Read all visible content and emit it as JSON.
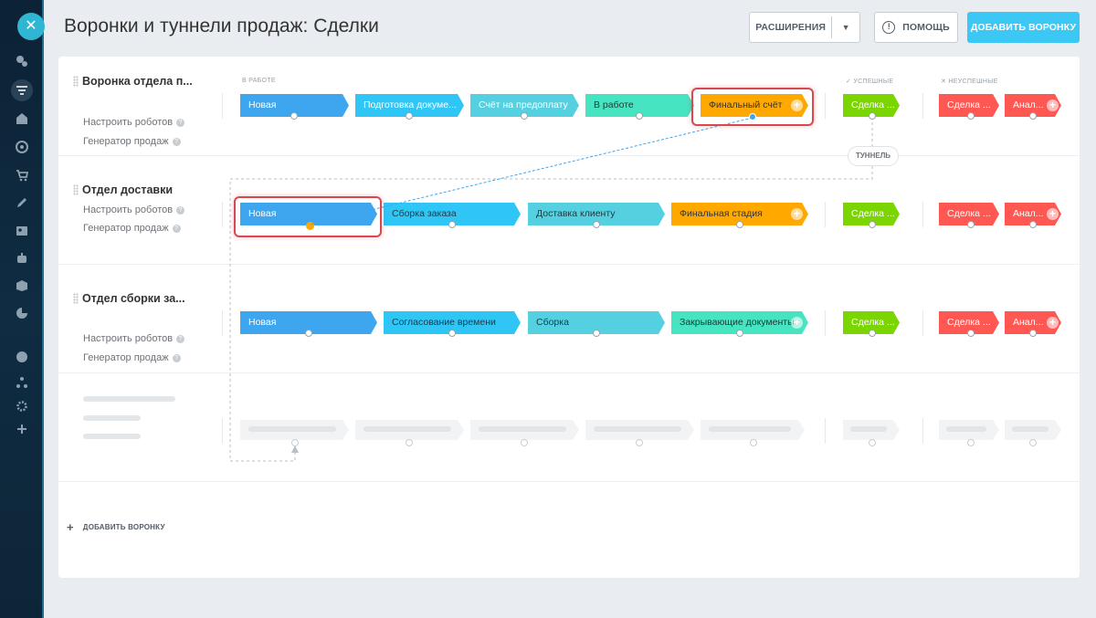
{
  "header": {
    "title": "Воронки и туннели продаж: Сделки",
    "extensions_label": "РАСШИРЕНИЯ",
    "help_label": "ПОМОЩЬ",
    "add_funnel_label": "ДОБАВИТЬ ВОРОНКУ"
  },
  "columns": {
    "in_work": "В РАБОТЕ",
    "success": "✓ УСПЕШНЫЕ",
    "failed": "✕ НЕУСПЕШНЫЕ"
  },
  "funnels": [
    {
      "name": "Воронка отдела п...",
      "robots_link": "Настроить роботов",
      "generator_link": "Генератор продаж",
      "stages": [
        "Новая",
        "Подготовка докуме...",
        "Счёт на предоплату",
        "В работе",
        "Финальный счёт"
      ],
      "success_stage": "Сделка ...",
      "failed_stages": [
        "Сделка ...",
        "Анал..."
      ]
    },
    {
      "name": "Отдел доставки",
      "robots_link": "Настроить роботов",
      "generator_link": "Генератор продаж",
      "stages": [
        "Новая",
        "Сборка заказа",
        "Доставка клиенту",
        "Финальная стадия"
      ],
      "success_stage": "Сделка ...",
      "failed_stages": [
        "Сделка ...",
        "Анал..."
      ]
    },
    {
      "name": "Отдел сборки за...",
      "robots_link": "Настроить роботов",
      "generator_link": "Генератор продаж",
      "stages": [
        "Новая",
        "Согласование времени",
        "Сборка",
        "Закрывающие документы"
      ],
      "success_stage": "Сделка ...",
      "failed_stages": [
        "Сделка ...",
        "Анал..."
      ]
    }
  ],
  "tunnel_label": "ТУННЕЛЬ",
  "footer": {
    "add_funnel_link": "ДОБАВИТЬ ВОРОНКУ"
  },
  "colors": {
    "blue": "#3ea5ef",
    "lightblue": "#2fc6f6",
    "teal": "#55d0e0",
    "mint": "#47e4c2",
    "orange": "#ffa900",
    "green": "#7bd500",
    "red": "#ff5752",
    "accent_button": "#3bc8f5",
    "highlight": "#d9484e"
  },
  "icons": [
    "close-icon",
    "activity-icon",
    "filter-icon",
    "home-icon",
    "target-icon",
    "cart-icon",
    "pen-icon",
    "contact-icon",
    "robot-icon",
    "box-icon",
    "chart-icon",
    "help-icon",
    "sitemap-icon",
    "gear-icon",
    "plus-icon"
  ]
}
